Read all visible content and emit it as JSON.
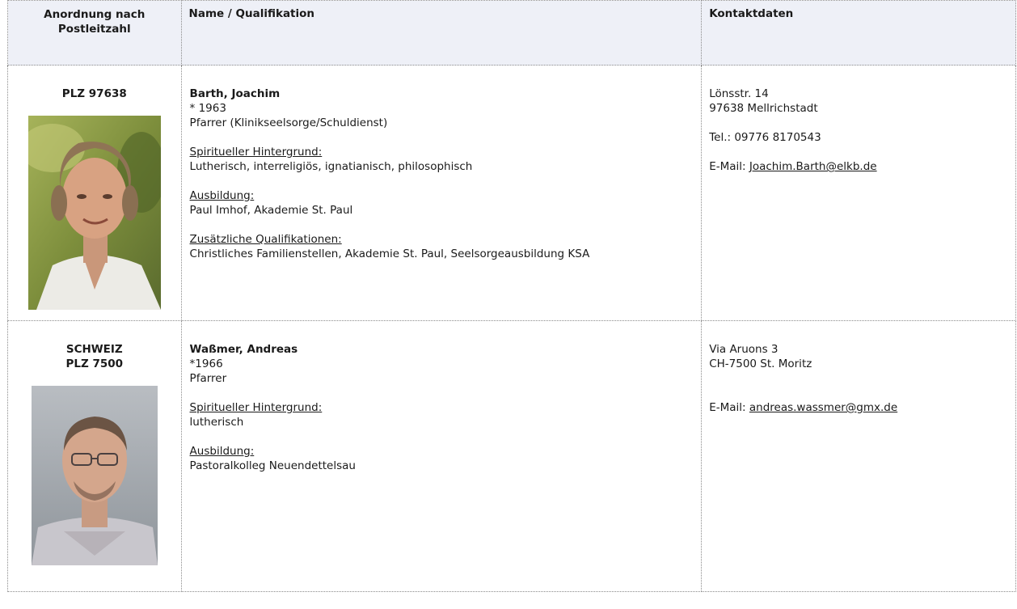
{
  "header": {
    "col1": "Anordnung nach Postleitzahl",
    "col2": "Name / Qualifikation",
    "col3": "Kontaktdaten"
  },
  "entries": [
    {
      "plz_lines": [
        "PLZ 97638"
      ],
      "name": "Barth, Joachim",
      "born": "* 1963",
      "role": "Pfarrer (Klinikseelsorge/Schuldienst)",
      "sections": [
        {
          "heading": "Spiritueller Hintergrund:",
          "text": "Lutherisch, interreligiös, ignatianisch, philosophisch"
        },
        {
          "heading": "Ausbildung:",
          "text": "Paul Imhof, Akademie St. Paul"
        },
        {
          "heading": "Zusätzliche Qualifikationen:",
          "text": "Christliches Familienstellen, Akademie St. Paul, Seelsorgeausbildung KSA"
        }
      ],
      "contact": {
        "street": "Lönsstr. 14",
        "city": "97638 Mellrichstadt",
        "tel": "Tel.: 09776 8170543",
        "email_label": "E-Mail:",
        "email": "Joachim.Barth@elkb.de"
      },
      "photo_icon": "portrait-photo",
      "photo_bg": "#8a9a4a"
    },
    {
      "plz_lines": [
        "SCHWEIZ",
        "PLZ 7500"
      ],
      "name": "Waßmer, Andreas",
      "born": "*1966",
      "role": "Pfarrer",
      "sections": [
        {
          "heading": "Spiritueller Hintergrund:",
          "text": "lutherisch"
        },
        {
          "heading": "Ausbildung:",
          "text": "Pastoralkolleg Neuendettelsau"
        }
      ],
      "contact": {
        "street": "Via Aruons 3",
        "city": "CH-7500 St. Moritz",
        "email_label": "E-Mail:",
        "email": "andreas.wassmer@gmx.de"
      },
      "photo_icon": "portrait-photo",
      "photo_bg": "#9aa0a6"
    }
  ]
}
